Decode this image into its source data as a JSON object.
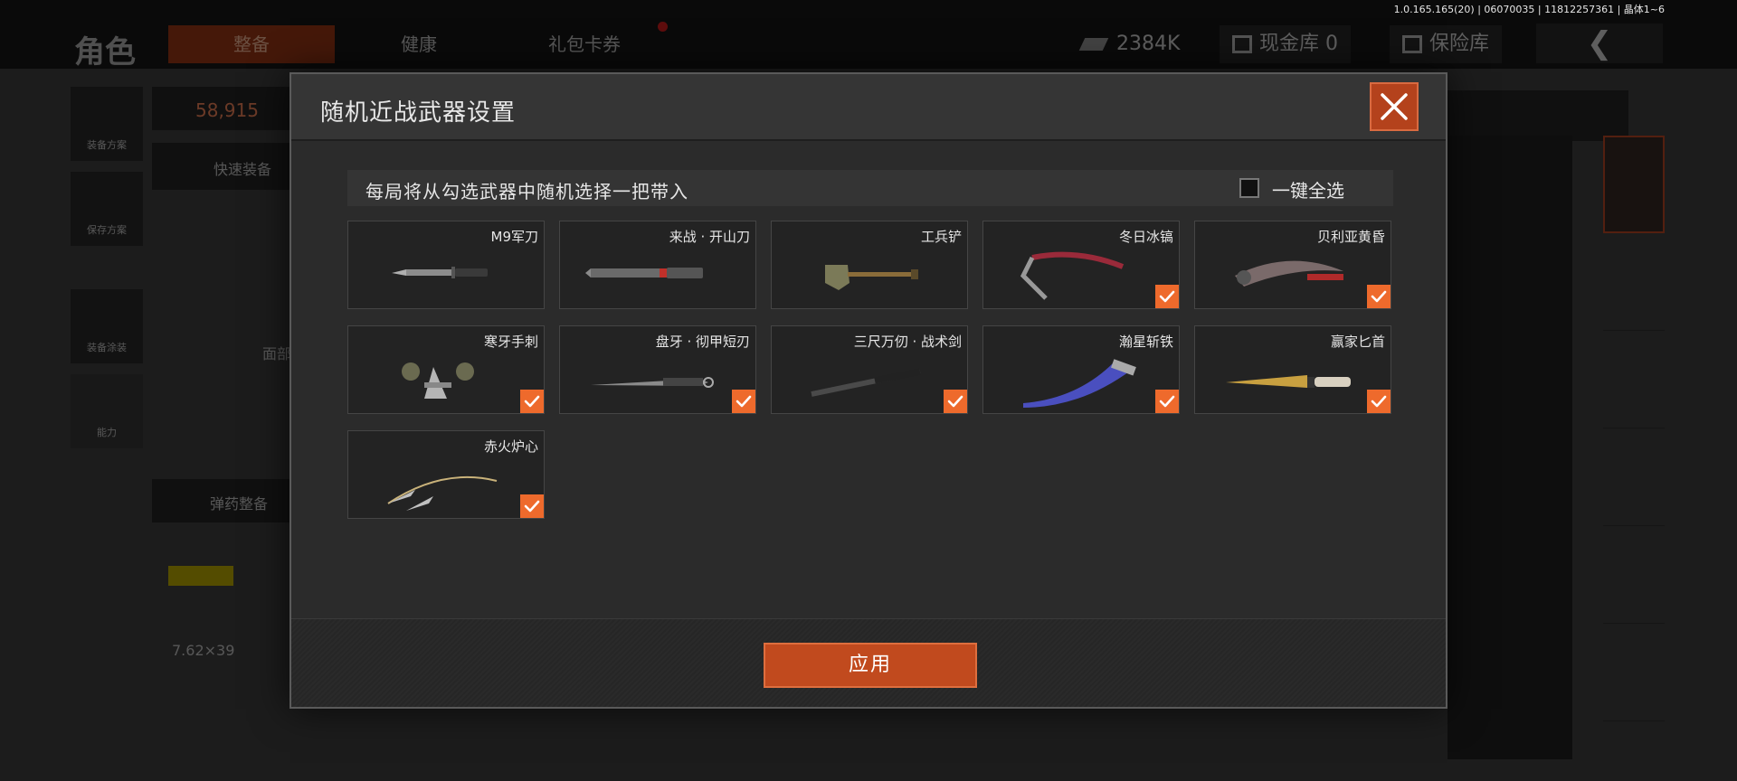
{
  "version_text": "1.0.165.165(20) | 06070035 | 11812257361 | 晶体1~6",
  "background": {
    "page_title": "角色",
    "tabs": [
      "整备",
      "健康",
      "礼包卡券"
    ],
    "cash": "2384K",
    "cash_vault": "现金库 0",
    "safe": "保险库",
    "back": "❮",
    "rail": [
      "装备方案",
      "保存方案",
      "装备涂装",
      "能力"
    ],
    "weight": "58,915",
    "quick_equip": "快速装备",
    "ammo_prep": "弹药整备",
    "ammo_caliber": "7.62×39",
    "face_label": "面部"
  },
  "modal": {
    "title": "随机近战武器设置",
    "info": "每局将从勾选武器中随机选择一把带入",
    "select_all": "一键全选",
    "apply": "应用",
    "accent_color": "#ee6a2c"
  },
  "weapons": [
    {
      "name": "M9军刀",
      "checked": false,
      "icon": "combat-knife"
    },
    {
      "name": "来战 · 开山刀",
      "checked": false,
      "icon": "machete"
    },
    {
      "name": "工兵铲",
      "checked": false,
      "icon": "shovel"
    },
    {
      "name": "冬日冰镐",
      "checked": true,
      "icon": "ice-pick"
    },
    {
      "name": "贝利亚黄昏",
      "checked": true,
      "icon": "curved-blade"
    },
    {
      "name": "寒牙手刺",
      "checked": true,
      "icon": "push-dagger"
    },
    {
      "name": "盘牙 · 彻甲短刃",
      "checked": true,
      "icon": "short-blade"
    },
    {
      "name": "三尺万仞 · 战术剑",
      "checked": true,
      "icon": "tactical-sword"
    },
    {
      "name": "瀚星斩铁",
      "checked": true,
      "icon": "kukri"
    },
    {
      "name": "赢家匕首",
      "checked": true,
      "icon": "gold-dagger"
    },
    {
      "name": "赤火炉心",
      "checked": true,
      "icon": "rope-darts"
    }
  ]
}
